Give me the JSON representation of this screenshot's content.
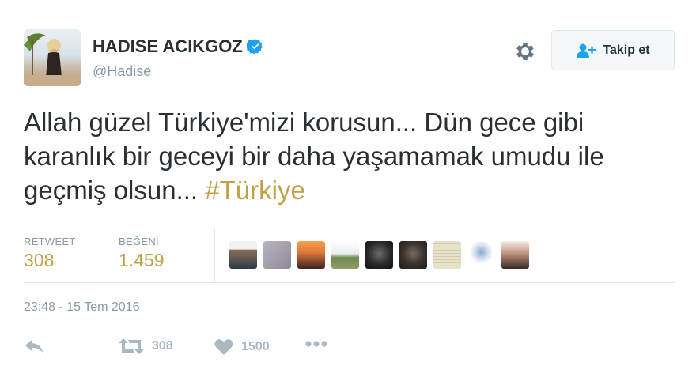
{
  "user": {
    "name": "HADISE ACIKGOZ",
    "handle": "@Hadise"
  },
  "follow_button": {
    "label": "Takip et"
  },
  "tweet": {
    "text": "Allah güzel Türkiye'mizi korusun... Dün gece gibi karanlık bir geceyi bir daha yaşamamak umudu ile geçmiş olsun...",
    "hashtag": "#Türkiye"
  },
  "stats": {
    "retweets": {
      "label": "RETWEET",
      "value": "308"
    },
    "likes": {
      "label": "BEĞENİ",
      "value": "1.459"
    }
  },
  "timestamp": "23:48 - 15 Tem 2016",
  "actions": {
    "retweet_count": "308",
    "like_count": "1500"
  },
  "colors": {
    "text": "#292f33",
    "muted": "#8899a6",
    "accent": "#c2a146",
    "verified": "#1da1f2",
    "follow_icon": "#1da1f2",
    "action_icon": "#aab8c2"
  },
  "icons": [
    "gear-icon",
    "verified-badge-icon",
    "follow-user-icon",
    "reply-icon",
    "retweet-icon",
    "like-heart-icon",
    "more-icon"
  ]
}
